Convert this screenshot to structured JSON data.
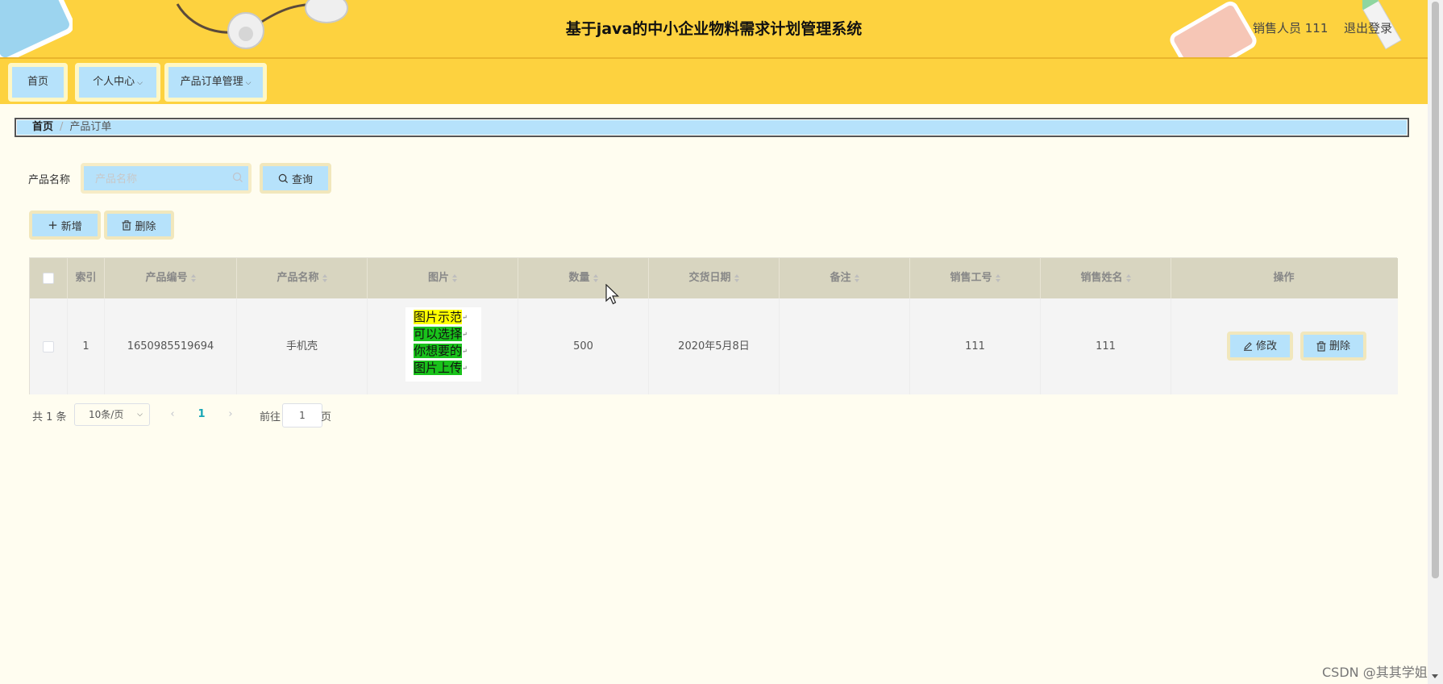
{
  "header": {
    "title": "基于java的中小企业物料需求计划管理系统",
    "user_label": "销售人员 111",
    "logout_label": "退出登录"
  },
  "nav": [
    {
      "label": "首页"
    },
    {
      "label": "个人中心",
      "has_dropdown": true
    },
    {
      "label": "产品订单管理",
      "has_dropdown": true
    }
  ],
  "breadcrumb": {
    "home": "首页",
    "separator": "/",
    "current": "产品订单"
  },
  "search": {
    "label": "产品名称",
    "placeholder": "产品名称",
    "value": "",
    "query_label": "查询",
    "icon": "search-icon"
  },
  "actions": {
    "add_label": "新增",
    "delete_label": "删除"
  },
  "table": {
    "columns": [
      {
        "label": ""
      },
      {
        "label": "索引"
      },
      {
        "label": "产品编号",
        "sortable": true
      },
      {
        "label": "产品名称",
        "sortable": true
      },
      {
        "label": "图片",
        "sortable": true
      },
      {
        "label": "数量",
        "sortable": true
      },
      {
        "label": "交货日期",
        "sortable": true
      },
      {
        "label": "备注",
        "sortable": true
      },
      {
        "label": "销售工号",
        "sortable": true
      },
      {
        "label": "销售姓名",
        "sortable": true
      },
      {
        "label": "操作"
      }
    ],
    "rows": [
      {
        "index": "1",
        "product_no": "1650985519694",
        "product_name": "手机壳",
        "image_lines": [
          "图片示范",
          "可以选择",
          "你想要的",
          "图片上传"
        ],
        "quantity": "500",
        "delivery_date": "2020年5月8日",
        "remark": "",
        "sales_id": "111",
        "sales_name": "111",
        "edit_label": "修改",
        "delete_label": "删除"
      }
    ]
  },
  "pagination": {
    "total_label": "共 1 条",
    "page_size": "10条/页",
    "current_page": "1",
    "goto_label": "前往",
    "goto_value": "1",
    "goto_unit": "页"
  },
  "watermark": "CSDN @其其学姐",
  "colors": {
    "header_bg": "#fdd23f",
    "page_bg": "#fffdf0",
    "button_bg": "#b6e2fb",
    "table_header_bg": "#d8d5c0",
    "pager_active": "#16a5b5"
  }
}
